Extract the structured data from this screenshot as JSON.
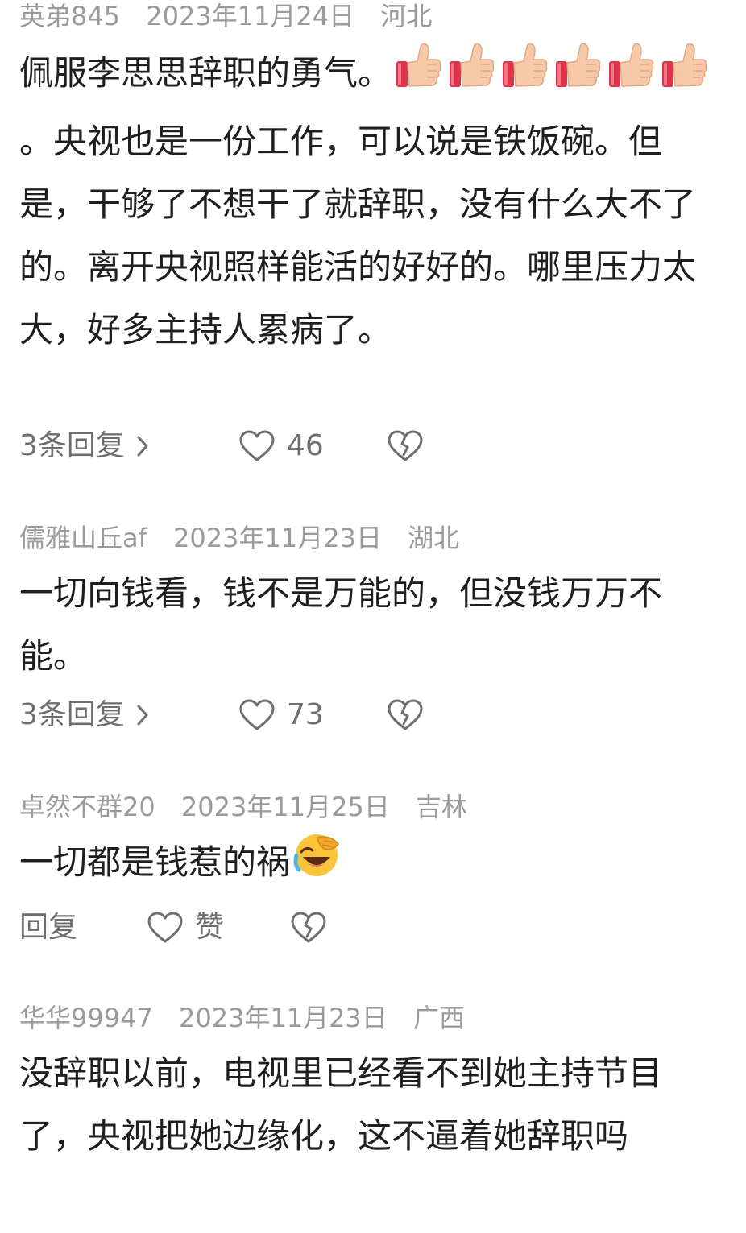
{
  "comments": [
    {
      "user": "英弟845",
      "date": "2023年11月24日",
      "location": "河北",
      "text_before": "佩服李思思辞职的勇气。",
      "emoji_a": "thumbs-up",
      "text_after": "。央视也是一份工作，可以说是铁饭碗。但是，干够了不想干了就辞职，没有什么大不了的。离开央视照样能活的好好的。哪里压力太大，好多主持人累病了。",
      "replies": "3条回复",
      "likes": "46",
      "like_icon": "heart-icon",
      "dislike_icon": "broken-heart-icon"
    },
    {
      "user": "儒雅山丘af",
      "date": "2023年11月23日",
      "location": "湖北",
      "text": "一切向钱看，钱不是万能的，但没钱万万不能。",
      "replies": "3条回复",
      "likes": "73",
      "like_icon": "heart-icon",
      "dislike_icon": "broken-heart-icon"
    },
    {
      "user": "卓然不群20",
      "date": "2023年11月25日",
      "location": "吉林",
      "text": "一切都是钱惹的祸",
      "emoji": "face-palm-laughing",
      "reply": "回复",
      "likes": "赞",
      "like_icon": "heart-icon",
      "dislike_icon": "broken-heart-icon"
    },
    {
      "user": "华华99947",
      "date": "2023年11月23日",
      "location": "广西",
      "text": "没辞职以前，电视里已经看不到她主持节目了，央视把她边缘化，这不逼着她辞职吗"
    }
  ],
  "colors": {
    "meta": "#9a9a9a",
    "text": "#1f1f1f",
    "action": "#6e6e6e"
  }
}
